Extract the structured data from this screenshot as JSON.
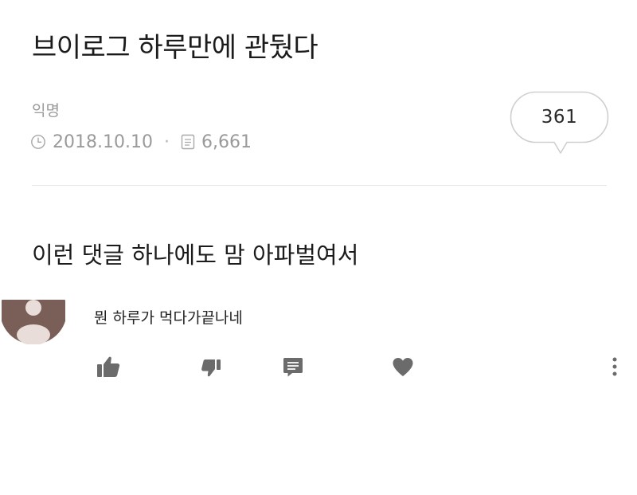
{
  "post": {
    "title": "브이로그 하루만에 관뒀다",
    "author": "익명",
    "date": "2018.10.10",
    "separator": "·",
    "views": "6,661",
    "comment_count": "361",
    "body": "이런 댓글 하나에도 맘 아파벌여서"
  },
  "comment": {
    "text": "뭔 하루가 먹다가끝나네"
  },
  "icons": {
    "date": "clock-icon",
    "views": "document-icon",
    "like": "thumbs-up-icon",
    "dislike": "thumbs-down-icon",
    "reply": "comment-icon",
    "favorite": "heart-icon",
    "more": "more-vertical-icon"
  },
  "colors": {
    "text": "#1b1b1b",
    "meta": "#9a9a9a",
    "icon": "#6b6b6b",
    "avatar": "#7a5e58",
    "avatar_face": "#e8ddd8"
  }
}
